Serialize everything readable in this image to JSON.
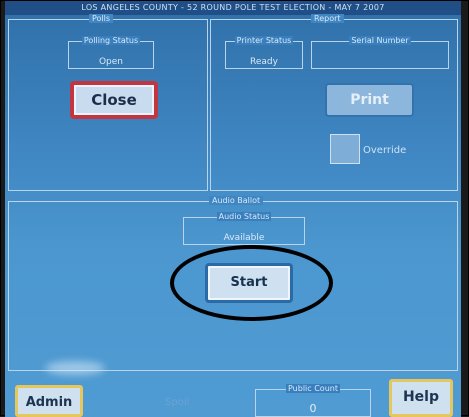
{
  "header": {
    "title": "LOS ANGELES COUNTY - 52 ROUND POLE TEST ELECTION - MAY 7 2007"
  },
  "polls_panel": {
    "title": "Polls",
    "status_label": "Polling Status",
    "status_value": "Open",
    "close_label": "Close"
  },
  "report_panel": {
    "title": "Report",
    "printer_status_label": "Printer Status",
    "printer_status_value": "Ready",
    "serial_label": "Serial Number",
    "serial_value": "",
    "print_label": "Print",
    "override_label": "Override"
  },
  "audio_panel": {
    "title": "Audio Ballot",
    "status_label": "Audio Status",
    "status_value": "Available",
    "start_label": "Start"
  },
  "footer": {
    "admin_label": "Admin",
    "faint_label": "Spoil",
    "public_count_label": "Public Count",
    "public_count_value": "0",
    "help_label": "Help"
  },
  "colors": {
    "screen_blue": "#3f86c2",
    "close_border": "#c23642",
    "gold_border": "#e6c75e",
    "annotation_circle": "#000000"
  }
}
